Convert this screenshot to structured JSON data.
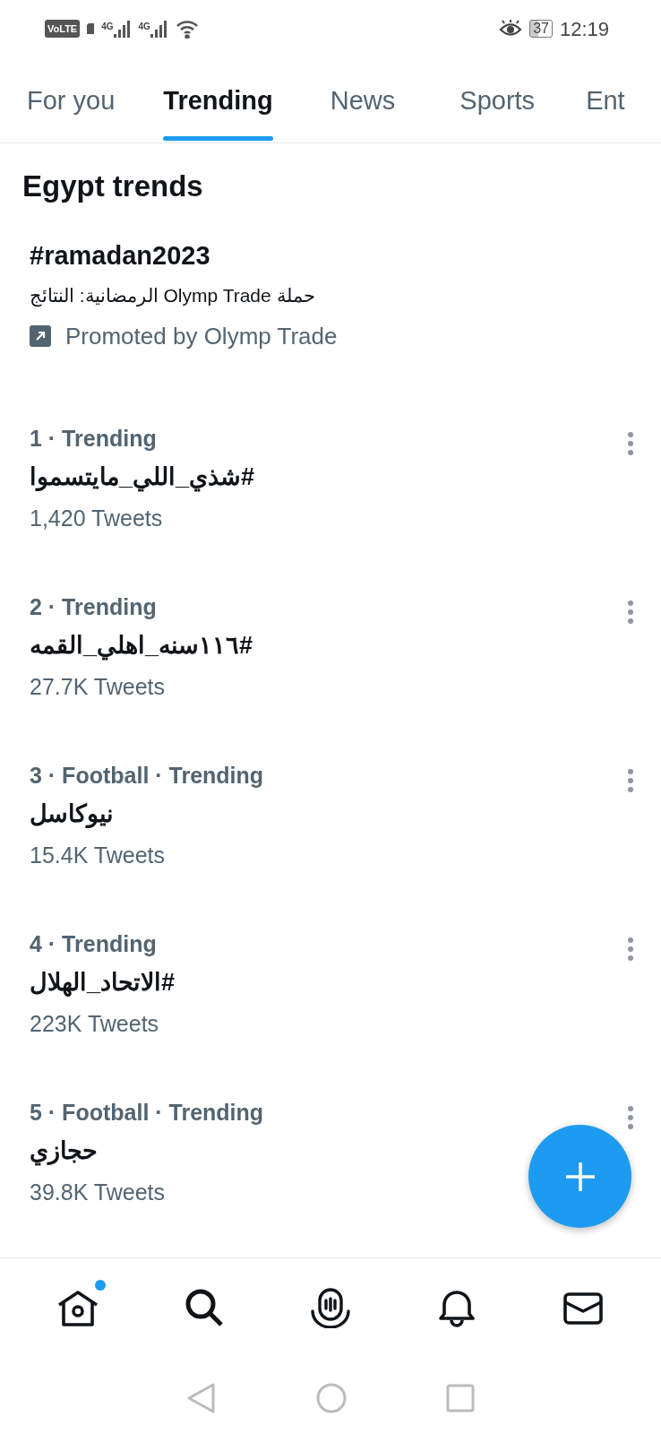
{
  "status_bar": {
    "volte": "VoLTE",
    "networks": [
      "4G",
      "4G"
    ],
    "battery": "37",
    "time": "12:19"
  },
  "tabs": [
    {
      "label": "For you",
      "selected": false
    },
    {
      "label": "Trending",
      "selected": true
    },
    {
      "label": "News",
      "selected": false
    },
    {
      "label": "Sports",
      "selected": false
    },
    {
      "label": "Ent",
      "selected": false
    }
  ],
  "section_title": "Egypt trends",
  "promoted": {
    "title": "#ramadan2023",
    "description": "حملة Olymp Trade الرمضانية: النتائج",
    "promoter": "Promoted by Olymp Trade"
  },
  "trends": [
    {
      "meta": "1 · Trending",
      "name": "#شذي_اللي_مايتسموا",
      "count": "1,420 Tweets"
    },
    {
      "meta": "2 · Trending",
      "name": "#١١٦سنه_اهلي_القمه",
      "count": "27.7K Tweets"
    },
    {
      "meta": "3 · Football · Trending",
      "name": "نيوكاسل",
      "count": "15.4K Tweets"
    },
    {
      "meta": "4 · Trending",
      "name": "#الاتحاد_الهلال",
      "count": "223K Tweets"
    },
    {
      "meta": "5 · Football · Trending",
      "name": "حجازي",
      "count": "39.8K Tweets"
    }
  ],
  "bottom_nav": [
    {
      "kind": "home",
      "unread": true
    },
    {
      "kind": "search",
      "unread": false
    },
    {
      "kind": "spaces",
      "unread": false
    },
    {
      "kind": "notifications",
      "unread": false
    },
    {
      "kind": "messages",
      "unread": false
    }
  ]
}
